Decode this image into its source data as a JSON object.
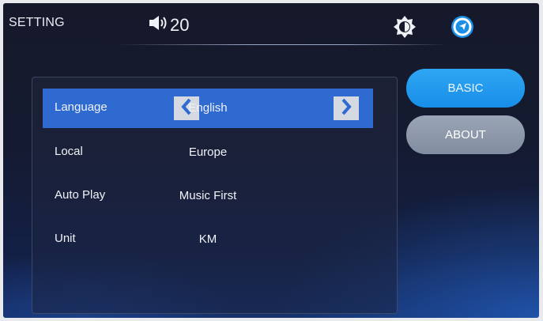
{
  "header": {
    "title": "SETTING",
    "volume_value": "20",
    "icons": [
      "speaker-icon",
      "brightness-icon",
      "navigation-app-icon"
    ]
  },
  "settings": {
    "rows": [
      {
        "label": "Language",
        "value": "English",
        "selected": true
      },
      {
        "label": "Local",
        "value": "Europe",
        "selected": false
      },
      {
        "label": "Auto Play",
        "value": "Music First",
        "selected": false
      },
      {
        "label": "Unit",
        "value": "KM",
        "selected": false
      }
    ]
  },
  "sidebar": {
    "buttons": [
      {
        "label": "BASIC",
        "active": true
      },
      {
        "label": "ABOUT",
        "active": false
      }
    ]
  },
  "colors": {
    "selected_row": "#2f6ad1",
    "active_button": "#1f9aee",
    "inactive_button": "#8c97a9"
  }
}
